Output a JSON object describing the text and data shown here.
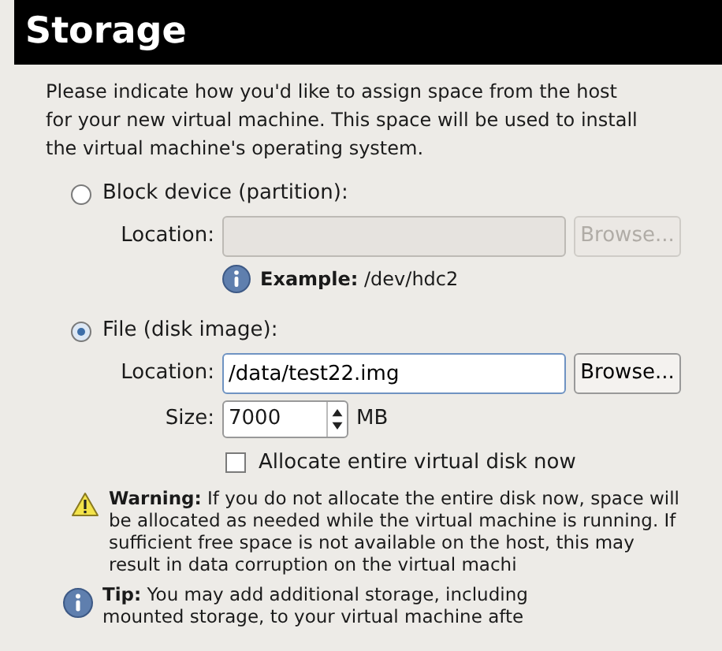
{
  "header": {
    "title": "Storage"
  },
  "intro": "Please indicate how you'd like to assign space from the host for your new virtual machine. This space will be used to install the virtual machine's operating system.",
  "options": [
    {
      "label": "Block device (partition):",
      "selected": false,
      "location": {
        "label": "Location:",
        "disabled": true
      },
      "browse": {
        "label": "Browse...",
        "disabled": true
      },
      "example": "**Example:** /dev/hdc2"
    },
    {
      "label": "File (disk image):",
      "selected": true,
      "location": {
        "label": "Location:",
        "value": "/data/test22.img",
        "disabled": false
      },
      "browse": {
        "label": "Browse...",
        "disabled": false
      },
      "size": {
        "label": "Size:",
        "value": "7000",
        "unit": "MB"
      },
      "allocate": {
        "label": "Allocate entire virtual disk now",
        "checked": false
      }
    }
  ],
  "notes": [
    {
      "kind": "warning",
      "lines": [
        "**Warning:** If you do not allocate the entire disk now, space will",
        "be allocated as needed while the virtual machine is running. If",
        "sufficient free space is not available on the host, this may",
        "result in data corruption on the virtual machi"
      ]
    },
    {
      "kind": "info",
      "lines": [
        "**Tip:** You may add additional storage, including",
        "mounted storage, to your virtual machine afte"
      ]
    }
  ]
}
